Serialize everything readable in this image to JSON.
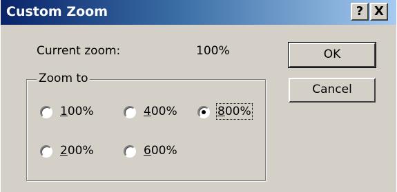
{
  "window": {
    "title": "Custom Zoom",
    "help_label": "?",
    "close_label": "X"
  },
  "current_zoom": {
    "label": "Current zoom:",
    "value": "100%"
  },
  "buttons": {
    "ok": "OK",
    "cancel": "Cancel"
  },
  "zoom_to": {
    "legend": "Zoom to",
    "selected": "800%",
    "options": [
      {
        "mnemonic": "1",
        "rest": "00%",
        "checked": false
      },
      {
        "mnemonic": "4",
        "rest": "00%",
        "checked": false
      },
      {
        "mnemonic": "8",
        "rest": "00%",
        "checked": true
      },
      {
        "mnemonic": "2",
        "rest": "00%",
        "checked": false
      },
      {
        "mnemonic": "6",
        "rest": "00%",
        "checked": false
      }
    ]
  }
}
